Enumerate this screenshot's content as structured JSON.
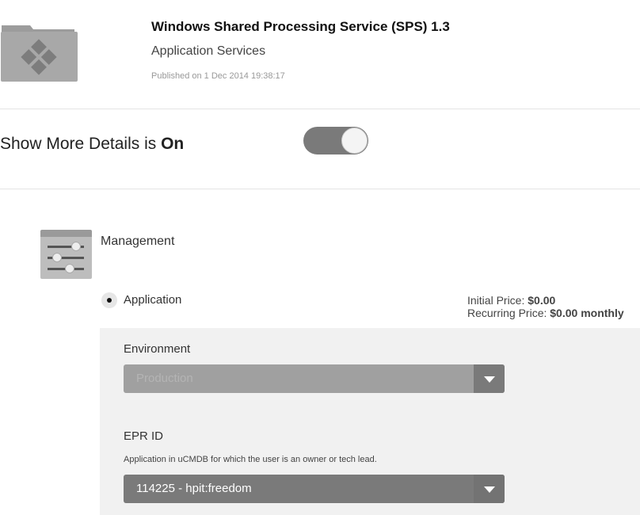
{
  "header": {
    "title": "Windows Shared Processing Service (SPS) 1.3",
    "category": "Application Services",
    "published": "Published on 1 Dec 2014 19:38:17",
    "icon": "folder-windows-icon"
  },
  "details_toggle": {
    "label": "Show More Details is ",
    "state": "On",
    "on": true
  },
  "section": {
    "title": "Management",
    "icon": "sliders-icon"
  },
  "option": {
    "label": "Application",
    "selected": true,
    "initial_price_label": "Initial Price: ",
    "initial_price": "$0.00",
    "recurring_price_label": "Recurring Price: ",
    "recurring_price": "$0.00 monthly"
  },
  "fields": {
    "environment": {
      "label": "Environment",
      "value": "Production",
      "disabled": true
    },
    "epr": {
      "label": "EPR ID",
      "help": "Application in uCMDB for which the user is an owner or tech lead.",
      "value": "114225 - hpit:freedom"
    }
  }
}
